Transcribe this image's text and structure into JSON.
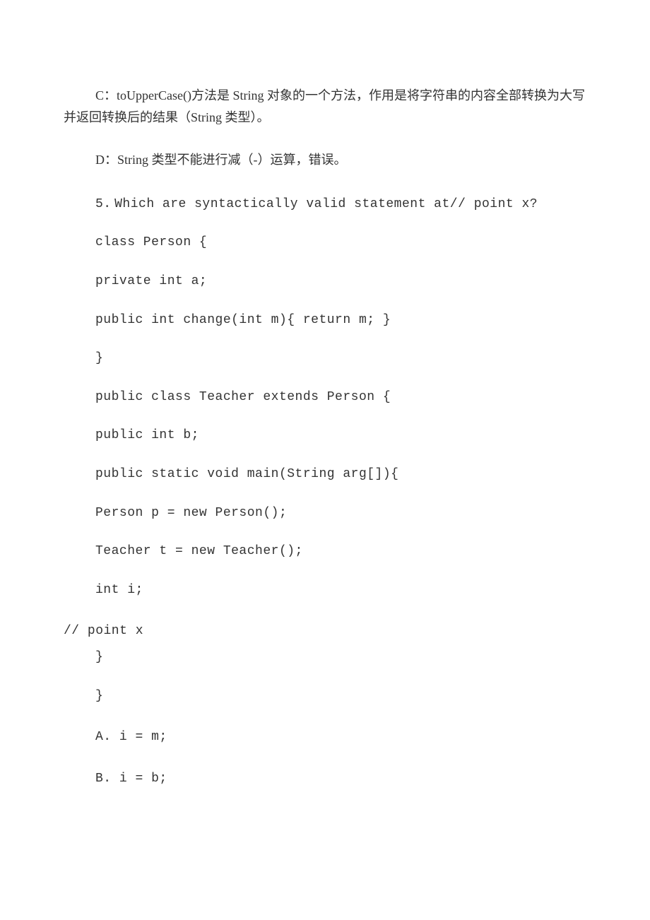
{
  "paragraphs": {
    "c": "C：toUpperCase()方法是 String 对象的一个方法，作用是将字符串的内容全部转换为大写并返回转换后的结果（String 类型）。",
    "d": "D：String 类型不能进行减（-）运算，错误。"
  },
  "question": {
    "number": "5.",
    "text": "Which are syntactically valid statement at// point x?"
  },
  "code": {
    "l1": "class Person {",
    "l2": "private int a;",
    "l3": "public int change(int m){ return m; }",
    "l4": "}",
    "l5": "public class Teacher extends Person {",
    "l6": "public int b;",
    "l7": "public static void main(String arg[]){",
    "l8": "Person p = new Person();",
    "l9": "Teacher t = new Teacher();",
    "l10": "int i;",
    "comment": "// point x",
    "l11": "}",
    "l12": "}"
  },
  "options": {
    "a": "A. i = m;",
    "b": "B. i = b;"
  }
}
